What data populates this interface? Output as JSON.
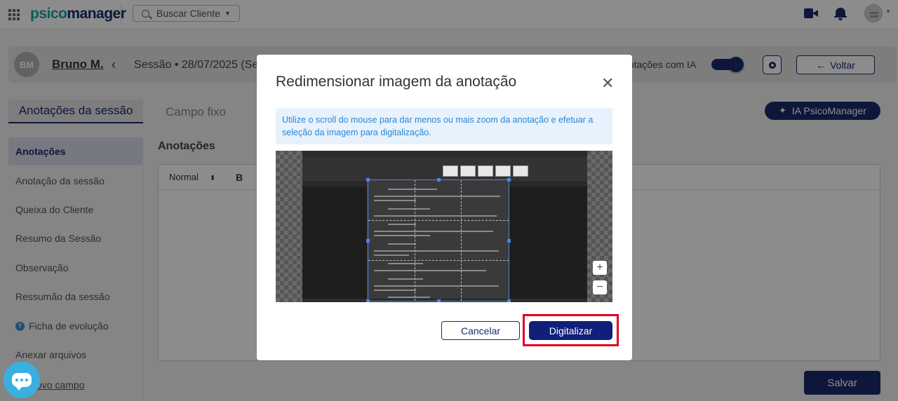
{
  "topbar": {
    "logo_part1": "psico",
    "logo_part2": "manager",
    "search_label": "Buscar Cliente"
  },
  "session": {
    "avatar_initials": "BM",
    "patient_name": "Bruno M.",
    "title": "Sessão • 28/07/2025 (Se",
    "ai_toggle_label": "notações com IA",
    "ai_toggle_on": true,
    "back_label": "Voltar"
  },
  "tabs": {
    "active": "Anotações da sessão",
    "inactive": "Campo fixo",
    "ia_button": "IA PsicoManager"
  },
  "sidebar": {
    "items": [
      {
        "label": "Anotações",
        "active": true
      },
      {
        "label": "Anotação da sessão"
      },
      {
        "label": "Queixa do Cliente"
      },
      {
        "label": "Resumo da Sessão"
      },
      {
        "label": "Observação"
      },
      {
        "label": "Ressumão da sessão"
      },
      {
        "label": "Ficha de evolução",
        "icon": "help-icon"
      },
      {
        "label": "Anexar arquivos"
      },
      {
        "label": "ovo campo"
      }
    ]
  },
  "editor": {
    "section_title": "Anotações",
    "format_value": "Normal",
    "bold_label": "B",
    "save_label": "Salvar"
  },
  "modal": {
    "title": "Redimensionar imagem da anotação",
    "info_text": "Utilize o scroll do mouse para dar menos ou mais zoom da anotação e efetuar a seleção da imagem para digitalização.",
    "zoom_in": "+",
    "zoom_out": "−",
    "cancel_label": "Cancelar",
    "confirm_label": "Digitalizar"
  },
  "colors": {
    "brand_navy": "#1a2a6c",
    "brand_teal": "#13a89e",
    "info_text": "#2a86d6",
    "highlight_red": "#e0001b"
  }
}
